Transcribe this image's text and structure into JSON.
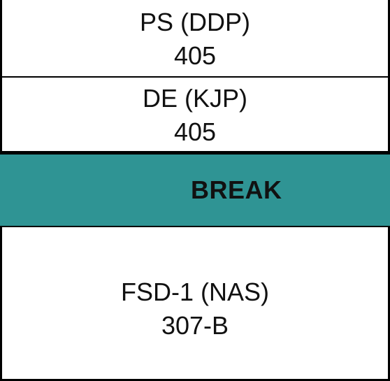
{
  "slots": [
    {
      "subject": "PS (DDP)",
      "room": "405"
    },
    {
      "subject": "DE (KJP)",
      "room": "405"
    },
    {
      "label": "BREAK",
      "color": "#2f9494"
    },
    {
      "subject": "FSD-1 (NAS)",
      "room": "307-B"
    }
  ]
}
